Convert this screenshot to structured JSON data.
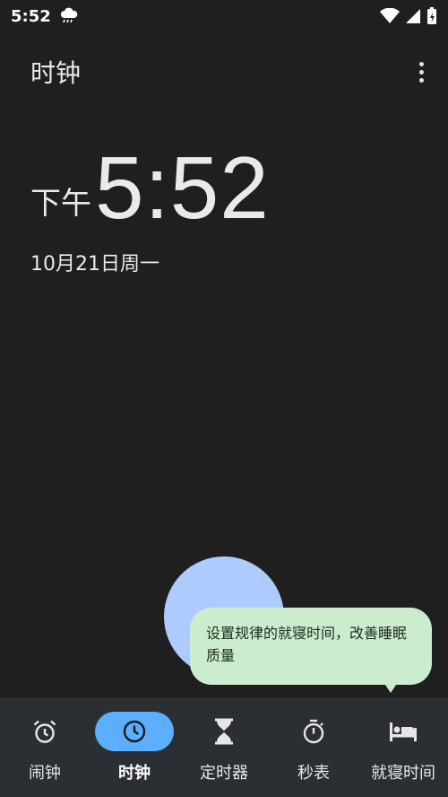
{
  "status_bar": {
    "time": "5:52"
  },
  "app_bar": {
    "title": "时钟"
  },
  "clock": {
    "ampm": "下午",
    "time": "5:52",
    "date": "10月21日周一"
  },
  "tooltip": {
    "text": "设置规律的就寝时间，改善睡眠质量"
  },
  "bottom_nav": {
    "items": [
      {
        "label": "闹钟",
        "icon": "alarm-icon"
      },
      {
        "label": "时钟",
        "icon": "clock-icon",
        "active": true
      },
      {
        "label": "定时器",
        "icon": "hourglass-icon"
      },
      {
        "label": "秒表",
        "icon": "stopwatch-icon"
      },
      {
        "label": "就寝时间",
        "icon": "bed-icon"
      }
    ]
  },
  "colors": {
    "background": "#1f1f1f",
    "nav_background": "#2b2f33",
    "active_pill": "#5caeff",
    "tooltip_bg": "#cbeccd",
    "blob": "#aecbff"
  }
}
